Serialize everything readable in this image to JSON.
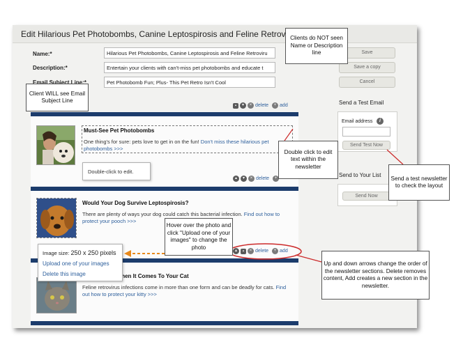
{
  "page_title": "Edit Hilarious Pet Photobombs, Canine Leptospirosis and Feline Retrovirus",
  "form": {
    "name_label": "Name:*",
    "name_value": "Hilarious Pet Photobombs, Canine Leptospirosis and Feline Retroviru",
    "description_label": "Description:*",
    "description_value": "Entertain your clients with can't-miss pet photobombs and educate t",
    "subject_label": "Email Subject Line:*",
    "subject_value": "Pet Photobomb Fun; Plus- This Pet Retro Isn't Cool"
  },
  "buttons": {
    "save": "Save",
    "save_copy": "Save a copy",
    "cancel": "Cancel"
  },
  "test_email": {
    "heading": "Send a Test Email",
    "address_label": "Email address",
    "address_value": "",
    "button": "Send Test Now"
  },
  "send_list": {
    "heading": "Send to Your List",
    "button": "Send Now"
  },
  "section_controls": {
    "delete": "delete",
    "add": "add"
  },
  "sections": [
    {
      "heading": "Must-See Pet Photobombs",
      "text": "One thing's for sure: pets love to get in on the fun! ",
      "link": "Don't miss these hilarious pet photobombs >>>",
      "edit_hint": "Double-click to edit."
    },
    {
      "heading": "Would Your Dog Survive Leptospirosis?",
      "text": "There are plenty of ways your dog could catch this bacterial infection. ",
      "link": "Find out how to protect your pooch >>>"
    },
    {
      "heading": "s Cool When It Comes To Your Cat",
      "text": "Feline retrovirus infections come in more than one form and can be deadly for cats. ",
      "link": "Find out how to protect your kitty >>>"
    }
  ],
  "image_menu": {
    "size_label": "Image size:",
    "size_value": "250 x 250 pixels",
    "upload": "Upload one of your images",
    "delete": "Delete this image"
  },
  "callouts": {
    "no_name": "Clients do NOT seen Name or Description line",
    "subject": "Client WILL see Email Subject Line",
    "double_click": "Double click to edit text within the newsletter",
    "send_test": "Send a test newsletter to check the layout",
    "hover_photo": "Hover over the photo and click \"Upload one of your images\" to change the photo",
    "arrows": "Up and down arrows change the order of the newsletter sections. Delete removes content, Add creates a new section in the newsletter."
  },
  "colors": {
    "section_bar": "#1c3c6c",
    "link": "#2d5f9c",
    "orange_arrow": "#e8891c",
    "callout_line": "#cc2a2a"
  }
}
